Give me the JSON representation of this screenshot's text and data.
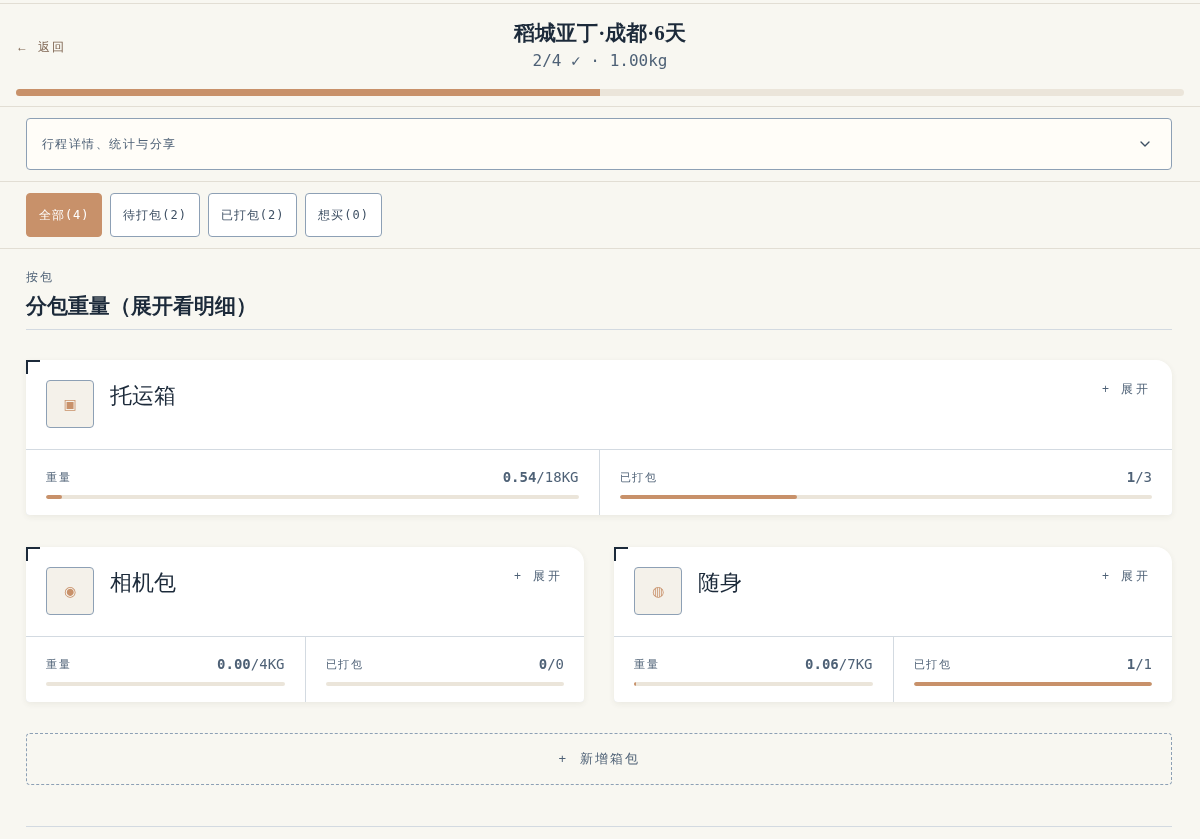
{
  "header": {
    "back": "← 返回",
    "title": "稻城亚丁·成都·6天",
    "subtitle": "2/4 ✓ · 1.00kg",
    "progress": {
      "level": 0.5
    }
  },
  "details_panel": {
    "label": "行程详情、统计与分享",
    "expanded": false
  },
  "filter_tabs": [
    {
      "label": "全部(4)",
      "selected": true
    },
    {
      "label": "待打包(2)",
      "selected": false
    },
    {
      "label": "已打包(2)",
      "selected": false
    },
    {
      "label": "想买(0)",
      "selected": false
    }
  ],
  "section": {
    "eyebrow": "按包",
    "title": "分包重量（展开看明细）"
  },
  "bags": [
    {
      "name": "托运箱",
      "icon": "▣",
      "wide": true,
      "expand": "+ 展开",
      "stats": [
        {
          "label": "重量",
          "value": "**0.54**/18KG",
          "level": 0.03
        },
        {
          "label": "已打包",
          "value": "**1**/3",
          "level": 0.333
        }
      ]
    },
    {
      "name": "相机包",
      "icon": "◉",
      "wide": false,
      "expand": "+ 展开",
      "stats": [
        {
          "label": "重量",
          "value": "**0.00**/4KG"
        },
        {
          "label": "已打包",
          "value": "**0**/0"
        }
      ]
    },
    {
      "name": "随身",
      "icon": "◍",
      "wide": false,
      "expand": "+ 展开",
      "stats": [
        {
          "label": "重量",
          "value": "**0.06**/7KG",
          "level": 0.009
        },
        {
          "label": "已打包",
          "value": "**1**/1",
          "level": 1
        }
      ]
    }
  ],
  "add_button": "+ 新增箱包"
}
